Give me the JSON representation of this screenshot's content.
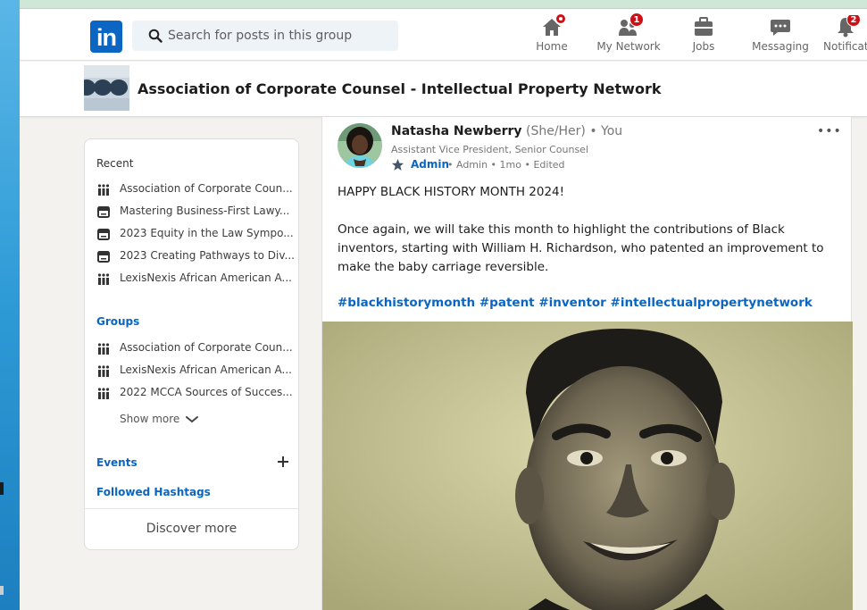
{
  "nav": {
    "search_placeholder": "Search for posts in this group",
    "items": [
      {
        "label": "Home",
        "icon": "home-icon"
      },
      {
        "label": "My Network",
        "icon": "network-icon",
        "badge": "1"
      },
      {
        "label": "Jobs",
        "icon": "briefcase-icon"
      },
      {
        "label": "Messaging",
        "icon": "messaging-icon"
      },
      {
        "label": "Notificat",
        "icon": "bell-icon",
        "badge": "2"
      }
    ],
    "logo": "in"
  },
  "group": {
    "title": "Association of Corporate Counsel - Intellectual Property Network"
  },
  "sidebar": {
    "recent_title": "Recent",
    "recent": [
      {
        "label": "Association of Corporate Coun...",
        "icon": "group-icon"
      },
      {
        "label": "Mastering Business-First Lawy...",
        "icon": "event-icon"
      },
      {
        "label": "2023 Equity in the Law Sympo...",
        "icon": "event-icon"
      },
      {
        "label": "2023 Creating Pathways to Div...",
        "icon": "event-icon"
      },
      {
        "label": "LexisNexis African American A...",
        "icon": "group-icon"
      }
    ],
    "groups_title": "Groups",
    "groups": [
      {
        "label": "Association of Corporate Coun...",
        "icon": "group-icon"
      },
      {
        "label": "LexisNexis African American A...",
        "icon": "group-icon"
      },
      {
        "label": "2022 MCCA Sources of Succes...",
        "icon": "group-icon"
      }
    ],
    "show_more": "Show more",
    "events": "Events",
    "hashtags": "Followed Hashtags",
    "discover": "Discover more"
  },
  "post": {
    "author": "Natasha Newberry",
    "pronouns_you": " (She/Her) • You",
    "subtitle": "Assistant Vice President, Senior Counsel",
    "admin": "Admin",
    "meta": "• Admin • 1mo • Edited",
    "more": "•••",
    "paragraphs": [
      "HAPPY BLACK HISTORY MONTH 2024!",
      "Once again, we will take this month to highlight the contributions of Black inventors, starting with William H. Richardson, who patented an improvement to make the baby carriage reversible."
    ],
    "hashtags": "#blackhistorymonth #patent #inventor #intellectualpropertynetwork"
  },
  "colors": {
    "linkedin_blue": "#0a66c2",
    "badge_red": "#cc1016",
    "page_bg": "#f3f2ef"
  }
}
